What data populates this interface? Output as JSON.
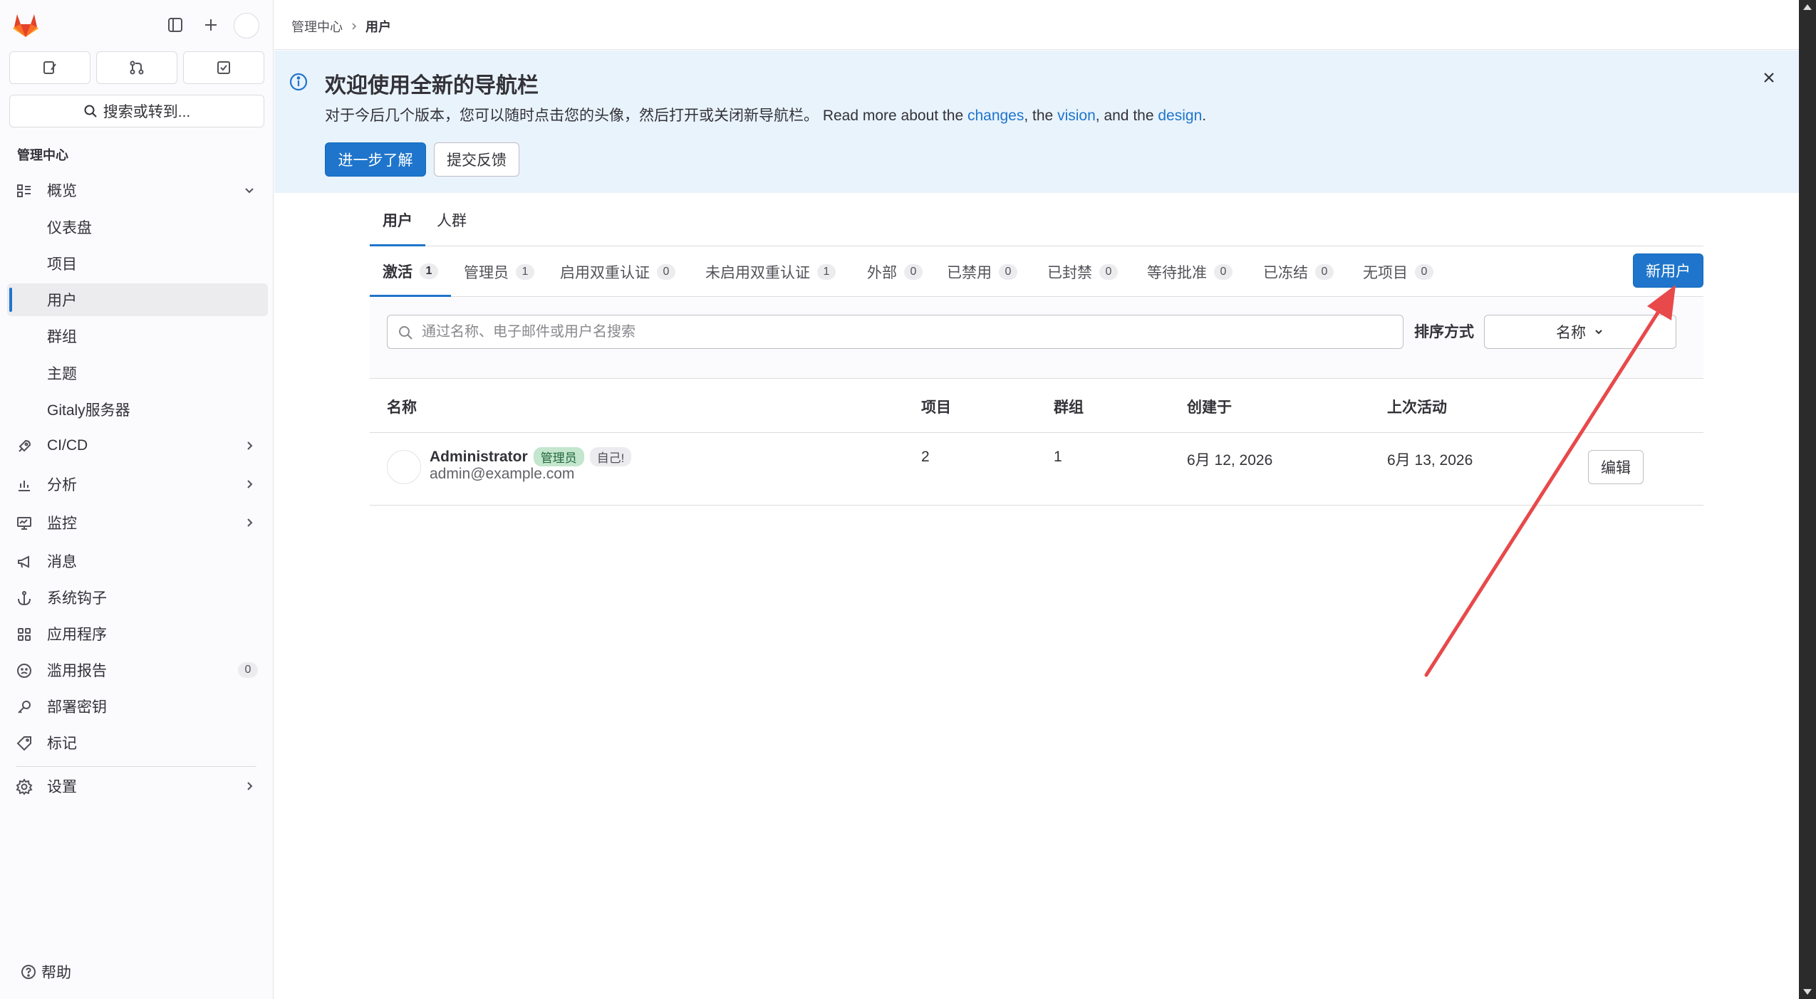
{
  "sidebar": {
    "search_label": "搜索或转到...",
    "section_title": "管理中心",
    "items": [
      {
        "label": "概览",
        "icon": "overview-icon",
        "chevron": "down"
      },
      {
        "label": "仪表盘"
      },
      {
        "label": "项目"
      },
      {
        "label": "用户",
        "active": true
      },
      {
        "label": "群组"
      },
      {
        "label": "主题"
      },
      {
        "label": "Gitaly服务器"
      },
      {
        "label": "CI/CD",
        "icon": "rocket-icon",
        "chevron": "right"
      },
      {
        "label": "分析",
        "icon": "chart-icon",
        "chevron": "right"
      },
      {
        "label": "监控",
        "icon": "monitor-icon",
        "chevron": "right"
      },
      {
        "label": "消息",
        "icon": "megaphone-icon"
      },
      {
        "label": "系统钩子",
        "icon": "anchor-icon"
      },
      {
        "label": "应用程序",
        "icon": "apps-icon"
      },
      {
        "label": "滥用报告",
        "icon": "frown-icon",
        "count": "0"
      },
      {
        "label": "部署密钥",
        "icon": "key-icon"
      },
      {
        "label": "标记",
        "icon": "label-icon"
      },
      {
        "label": "设置",
        "icon": "settings-icon",
        "chevron": "right"
      }
    ],
    "help_label": "帮助"
  },
  "breadcrumb": {
    "parent": "管理中心",
    "current": "用户"
  },
  "banner": {
    "title": "欢迎使用全新的导航栏",
    "text_before": "对于今后几个版本，您可以随时点击您的头像，然后打开或关闭新导航栏。 Read more about the ",
    "link_changes": "changes",
    "text_mid1": ", the ",
    "link_vision": "vision",
    "text_mid2": ", and the ",
    "link_design": "design",
    "text_end": ".",
    "learn_more": "进一步了解",
    "feedback": "提交反馈"
  },
  "main_tabs": {
    "users": "用户",
    "cohorts": "人群"
  },
  "sub_tabs": [
    {
      "label": "激活",
      "count": "1",
      "active": true
    },
    {
      "label": "管理员",
      "count": "1"
    },
    {
      "label": "启用双重认证",
      "count": "0"
    },
    {
      "label": "未启用双重认证",
      "count": "1"
    },
    {
      "label": "外部",
      "count": "0"
    },
    {
      "label": "已禁用",
      "count": "0"
    },
    {
      "label": "已封禁",
      "count": "0"
    },
    {
      "label": "等待批准",
      "count": "0"
    },
    {
      "label": "已冻结",
      "count": "0"
    },
    {
      "label": "无项目",
      "count": "0"
    }
  ],
  "new_user_label": "新用户",
  "filter": {
    "search_placeholder": "通过名称、电子邮件或用户名搜索",
    "sort_label": "排序方式",
    "sort_value": "名称"
  },
  "table": {
    "headers": {
      "name": "名称",
      "projects": "项目",
      "groups": "群组",
      "created": "创建于",
      "last_activity": "上次活动"
    },
    "rows": [
      {
        "name": "Administrator",
        "badge_admin": "管理员",
        "badge_self": "自己!",
        "email": "admin@example.com",
        "projects": "2",
        "groups": "1",
        "created": "6月 12, 2026",
        "last_activity": "6月 13, 2026",
        "edit_label": "编辑"
      }
    ]
  },
  "colors": {
    "primary": "#1f75cb",
    "annotation": "#e8494a",
    "banner_bg": "#e9f3fc"
  }
}
